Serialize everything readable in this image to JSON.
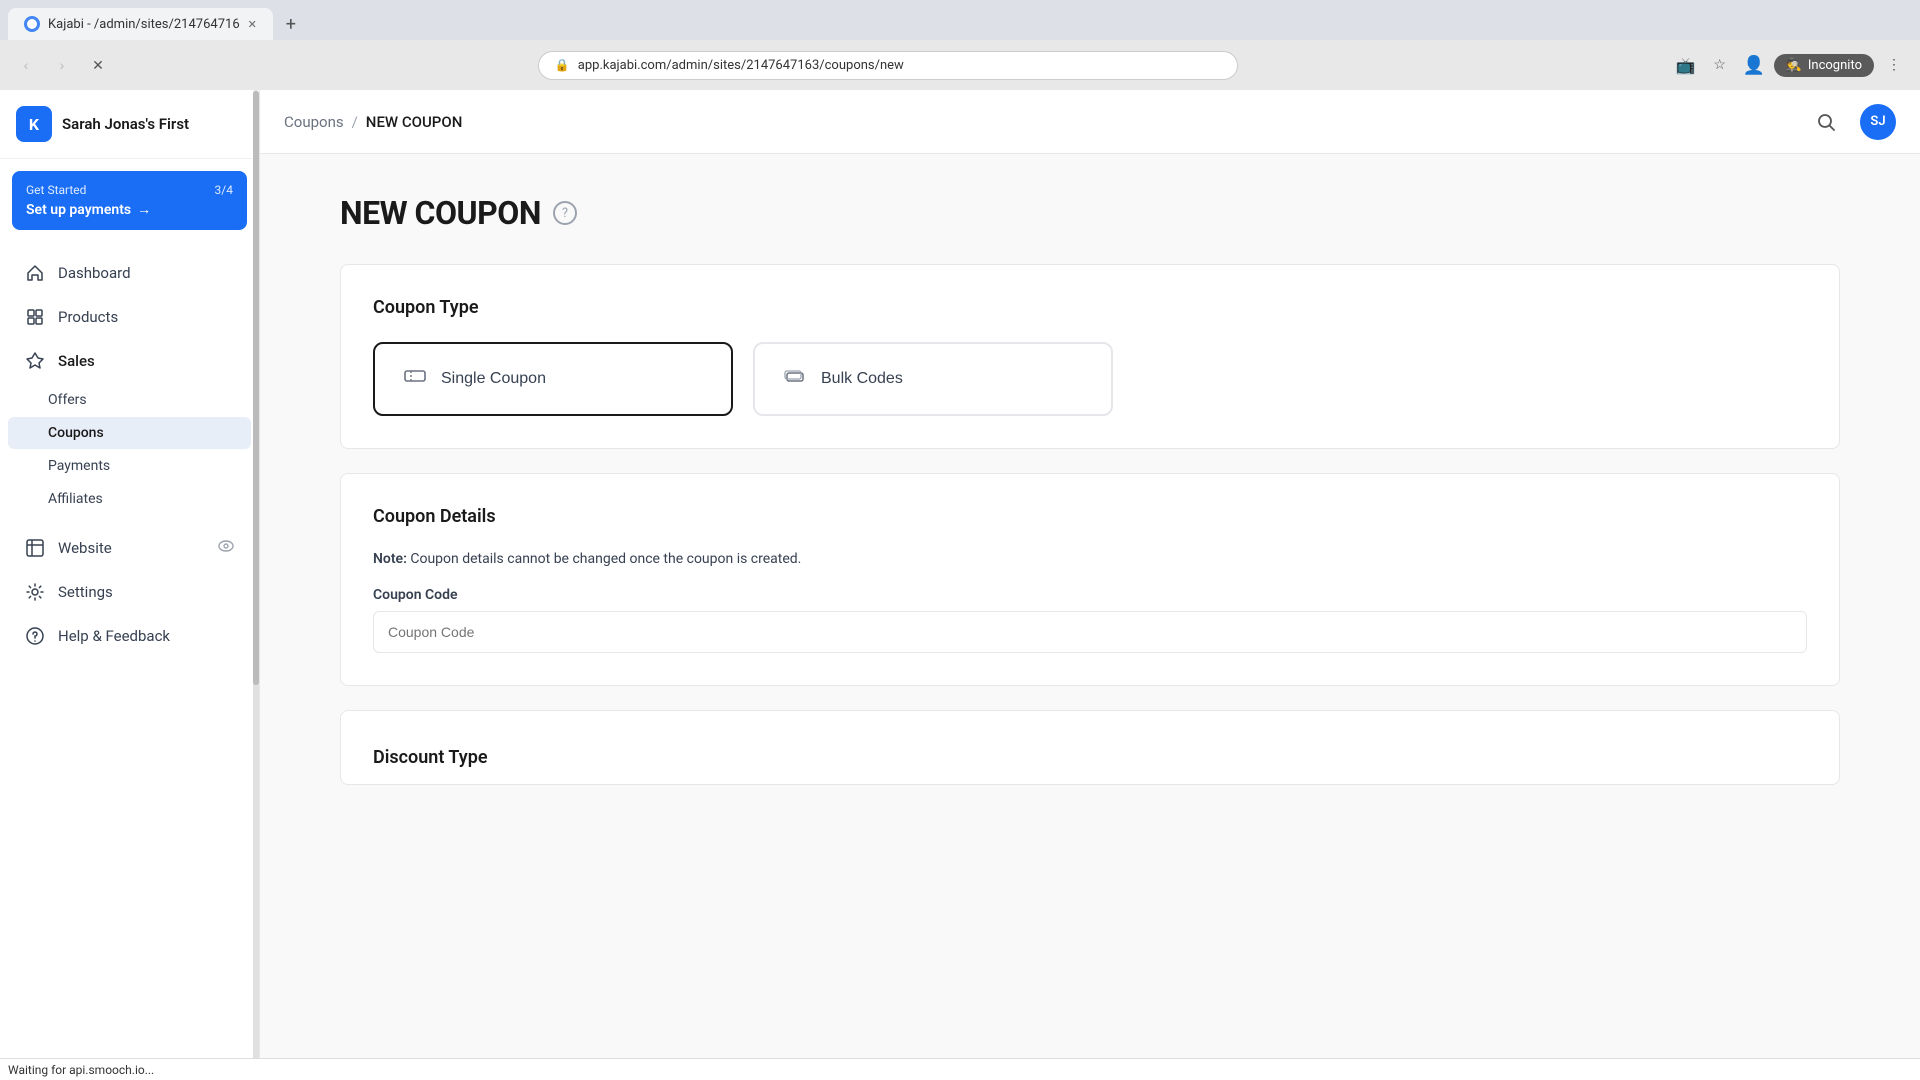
{
  "browser": {
    "tab_title": "Kajabi - /admin/sites/214764716",
    "tab_favicon": "K",
    "address_url": "app.kajabi.com/admin/sites/2147647163/coupons/new",
    "incognito_label": "Incognito",
    "loading": true
  },
  "status_bar": {
    "text": "Waiting for api.smooch.io..."
  },
  "sidebar": {
    "logo_text": "K",
    "site_name": "Sarah Jonas's First",
    "get_started": {
      "label": "Get Started",
      "progress": "3/4",
      "action": "Set up payments",
      "arrow": "→"
    },
    "nav_items": [
      {
        "id": "dashboard",
        "label": "Dashboard",
        "icon": "⌂"
      },
      {
        "id": "products",
        "label": "Products",
        "icon": "◻"
      },
      {
        "id": "sales",
        "label": "Sales",
        "icon": "◆"
      }
    ],
    "sub_items": [
      {
        "id": "offers",
        "label": "Offers"
      },
      {
        "id": "coupons",
        "label": "Coupons",
        "active": true
      },
      {
        "id": "payments",
        "label": "Payments"
      },
      {
        "id": "affiliates",
        "label": "Affiliates"
      }
    ],
    "bottom_items": [
      {
        "id": "website",
        "label": "Website",
        "icon": "◉"
      },
      {
        "id": "settings",
        "label": "Settings",
        "icon": "⚙"
      },
      {
        "id": "help",
        "label": "Help & Feedback",
        "icon": "?"
      }
    ]
  },
  "topbar": {
    "breadcrumb_parent": "Coupons",
    "breadcrumb_sep": "/",
    "breadcrumb_current": "NEW COUPON",
    "avatar_initials": "SJ"
  },
  "page": {
    "title": "NEW COUPON",
    "help_icon": "?",
    "coupon_type": {
      "section_title": "Coupon Type",
      "options": [
        {
          "id": "single",
          "label": "Single Coupon",
          "icon": "🏷",
          "selected": true
        },
        {
          "id": "bulk",
          "label": "Bulk Codes",
          "icon": "🗂",
          "selected": false
        }
      ]
    },
    "coupon_details": {
      "section_title": "Coupon Details",
      "note_prefix": "Note:",
      "note_text": " Coupon details cannot be changed once the coupon is created.",
      "coupon_code_label": "Coupon Code",
      "coupon_code_placeholder": "Coupon Code"
    },
    "discount_type": {
      "section_title": "Discount Type"
    }
  }
}
